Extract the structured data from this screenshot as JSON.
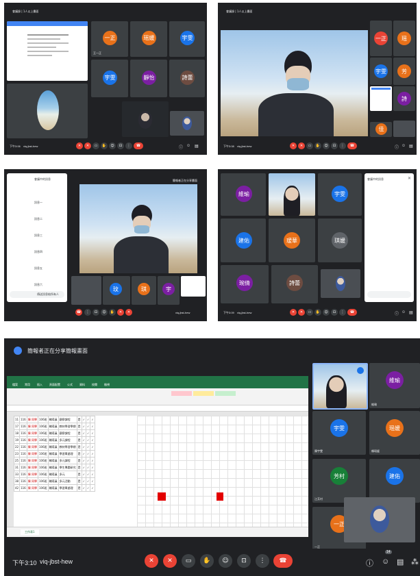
{
  "panel1": {
    "meeting_title": "會議錄 | 1人以上畫面",
    "tiles": [
      {
        "label": "一正",
        "color": "#e8711a",
        "name": "王一正"
      },
      {
        "label": "瑶媛",
        "color": "#e8711a",
        "name": "賴瑶媛"
      },
      {
        "label": "宇雯",
        "color": "#1a73e8",
        "name": "宇雯"
      },
      {
        "label": "宇雯",
        "color": "#1a73e8",
        "name": "宇雯"
      },
      {
        "label": "靜怡",
        "color": "#7b1fa2",
        "name": "靜怡"
      },
      {
        "label": "詩蕾",
        "color": "#6d4c41",
        "name": "詩蕾"
      }
    ],
    "time": "下午3:06",
    "code": "viq-jbst-hew"
  },
  "panel2": {
    "meeting_title": "會議錄 | 1人以上畫面",
    "side_tiles": [
      {
        "label": "一正",
        "color": "#ea4335"
      },
      {
        "label": "瑶",
        "color": "#e8711a"
      },
      {
        "label": "宇雯",
        "color": "#1a73e8"
      },
      {
        "label": "芳",
        "color": "#e8711a"
      },
      {
        "label": "詩",
        "color": "#7b1fa2"
      },
      {
        "label": "佳",
        "color": "#e8711a"
      }
    ],
    "time": "下午3:08",
    "code": "viq-jbst-hew"
  },
  "panel3": {
    "chat_title": "會議中的訊息",
    "messages": [
      "訊息一",
      "訊息二",
      "訊息三",
      "訊息四",
      "訊息五",
      "訊息六"
    ],
    "input_placeholder": "傳送訊息給所有人",
    "presenting": "簡報者正在分享畫面",
    "bottom_tiles": [
      {
        "label": "玟",
        "color": "#1a73e8"
      },
      {
        "label": "琪",
        "color": "#e8711a"
      },
      {
        "label": "宇",
        "color": "#7b1fa2"
      }
    ],
    "code": "viq-jbst-hew"
  },
  "panel4": {
    "tiles": [
      {
        "label": "維瑜",
        "color": "#7b1fa2"
      },
      {
        "label": "宇雯",
        "color": "#1a73e8"
      },
      {
        "label": "建佑",
        "color": "#1a73e8"
      },
      {
        "label": "瑷華",
        "color": "#e8711a"
      },
      {
        "label": "琪媛",
        "color": "#5f6368"
      },
      {
        "label": "琬倩",
        "color": "#7b1fa2"
      },
      {
        "label": "詩蕾",
        "color": "#6d4c41"
      }
    ],
    "chat_title": "會議中的訊息",
    "time": "下午3:09",
    "code": "viq-jbst-hew"
  },
  "panel5": {
    "presenting_title": "簡報者正在分享簡報畫面",
    "sheet_title": "Excel",
    "tabs": [
      "檔案",
      "常用",
      "插入",
      "頁面配置",
      "公式",
      "資料",
      "校閱",
      "檢視"
    ],
    "sheet_rows": [
      [
        "11",
        "116",
        "陳 同學",
        "106班",
        "輔導員",
        "觀察課程",
        "是",
        "✓",
        "✓",
        "✓"
      ],
      [
        "17",
        "116",
        "陳 同學",
        "106班",
        "輔導員",
        "教材學習學期",
        "是",
        "✓",
        "✓",
        "✓"
      ],
      [
        "18",
        "116",
        "陳 同學",
        "106班",
        "輔導員",
        "觀察課程",
        "是",
        "✓",
        "✓",
        "✓"
      ],
      [
        "19",
        "116",
        "陳 同學",
        "106班",
        "輔導員",
        "多元課程",
        "是",
        "✓",
        "✓",
        "✓"
      ],
      [
        "22",
        "116",
        "陳 同學",
        "106班",
        "輔導員",
        "教材學習學期",
        "是",
        "✓",
        "✓",
        "✓"
      ],
      [
        "23",
        "116",
        "陳 同學",
        "106班",
        "輔導員",
        "學習單處理",
        "是",
        "✓",
        "✓",
        "✓"
      ],
      [
        "25",
        "116",
        "陳 同學",
        "106班",
        "輔導員",
        "多元課程",
        "是",
        "✓",
        "✓",
        "✓"
      ],
      [
        "31",
        "116",
        "陳 同學",
        "106班",
        "輔導員",
        "學生專題研究",
        "是",
        "✓",
        "✓",
        "✓"
      ],
      [
        "33",
        "116",
        "陳 同學",
        "106班",
        "輔導員",
        "多元",
        "是",
        "✓",
        "✓",
        "✓"
      ],
      [
        "38",
        "116",
        "陳 同學",
        "106班",
        "輔導員",
        "多元活動",
        "是",
        "✓",
        "✓",
        "✓"
      ],
      [
        "42",
        "116",
        "陳 同學",
        "106班",
        "輔導員",
        "學習單處理",
        "是",
        "✓",
        "✓",
        "✓"
      ]
    ],
    "sheet_tab": "工作表1",
    "tiles": [
      {
        "label": "維瑜",
        "color": "#7b1fa2",
        "name": "維瑜"
      },
      {
        "label": "宇雯",
        "color": "#1a73e8",
        "name": "陳宇雯"
      },
      {
        "label": "瑶媛",
        "color": "#e8711a",
        "name": "賴瑶媛"
      },
      {
        "label": "芳村",
        "color": "#188038",
        "name": "江芳村"
      },
      {
        "label": "建佑",
        "color": "#1a73e8",
        "name": "陳建佑"
      },
      {
        "label": "一正",
        "color": "#e8711a",
        "name": "一正"
      }
    ],
    "time": "下午3:10",
    "code": "viq-jbst-hew",
    "participants_count": "14"
  }
}
